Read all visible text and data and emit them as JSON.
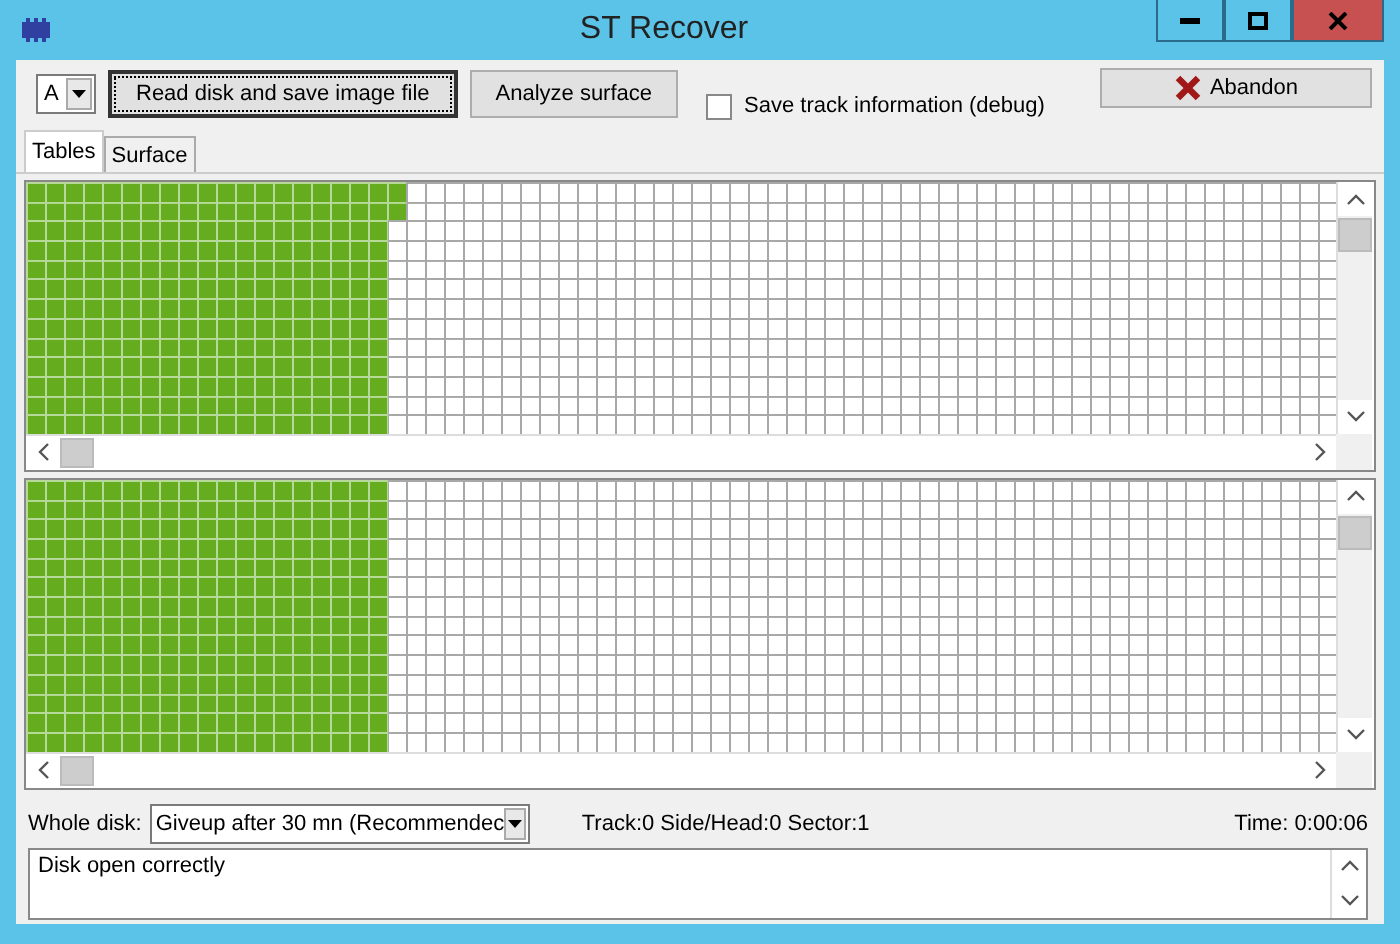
{
  "window": {
    "title": "ST Recover"
  },
  "toolbar": {
    "drive_select": {
      "value": "A"
    },
    "buttons": [
      {
        "label": "Read disk and save image file",
        "focused": true
      },
      {
        "label": "Analyze surface",
        "focused": false
      }
    ],
    "debug_checkbox": {
      "label": "Save track information (debug)",
      "checked": false
    },
    "abandon_button": {
      "label": "Abandon"
    }
  },
  "tabs": [
    {
      "label": "Tables",
      "selected": true
    },
    {
      "label": "Surface",
      "selected": false
    }
  ],
  "tables": [
    {
      "rows": [
        {
          "level": 0.29
        },
        {
          "level": 0.29
        },
        {
          "level": 0.275
        },
        {
          "level": 0.275
        },
        {
          "level": 0.275
        },
        {
          "level": 0.275
        },
        {
          "level": 0.275
        },
        {
          "level": 0.275
        },
        {
          "level": 0.275
        },
        {
          "level": 0.275
        },
        {
          "level": 0.275
        },
        {
          "level": 0.275
        },
        {
          "level": 0.275
        }
      ]
    },
    {
      "rows": [
        {
          "level": 0.275
        },
        {
          "level": 0.275
        },
        {
          "level": 0.275
        },
        {
          "level": 0.275
        },
        {
          "level": 0.275
        },
        {
          "level": 0.275
        },
        {
          "level": 0.275
        },
        {
          "level": 0.275
        },
        {
          "level": 0.275
        },
        {
          "level": 0.275
        },
        {
          "level": 0.275
        },
        {
          "level": 0.275
        },
        {
          "level": 0.275
        },
        {
          "level": 0.275
        }
      ]
    }
  ],
  "status": {
    "whole_disk_label": "Whole disk:",
    "giveup_select": {
      "value": "Giveup after 30 mn (Recommendec"
    },
    "position": "Track:0 Side/Head:0 Sector:1",
    "time": "Time: 0:00:06"
  },
  "log": [
    "Disk open correctly"
  ]
}
